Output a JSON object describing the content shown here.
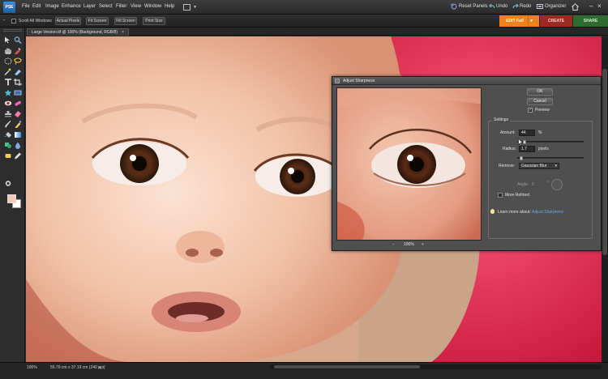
{
  "app": {
    "logo_text": "PSE",
    "menus": [
      "File",
      "Edit",
      "Image",
      "Enhance",
      "Layer",
      "Select",
      "Filter",
      "View",
      "Window",
      "Help"
    ],
    "right_buttons": {
      "reset_panels": "Reset Panels",
      "undo": "Undo",
      "redo": "Redo",
      "organizer": "Organizer"
    }
  },
  "options_bar": {
    "scroll_all_windows": "Scroll All Windows",
    "scroll_all_checked": false,
    "buttons": [
      "Actual Pixels",
      "Fit Screen",
      "Fill Screen",
      "Print Size"
    ]
  },
  "mode_tabs": {
    "edit": "EDIT Full",
    "create": "CREATE",
    "share": "SHARE",
    "colors": {
      "edit": "#f0821e",
      "create": "#9c2a22",
      "share": "#2f6b2f"
    }
  },
  "document": {
    "tab_title": "Large Version.tif @ 100% (Background, RGB/8)",
    "close_glyph": "×"
  },
  "toolbox": {
    "tools": [
      "move-tool",
      "zoom-tool",
      "hand-tool",
      "eyedropper-tool",
      "marquee-tool",
      "lasso-tool",
      "magic-wand-tool",
      "quick-selection-tool",
      "type-tool",
      "crop-tool",
      "cookie-cutter-tool",
      "straighten-tool",
      "red-eye-tool",
      "healing-brush-tool",
      "clone-stamp-tool",
      "eraser-tool",
      "brush-tool",
      "smart-brush-tool",
      "paint-bucket-tool",
      "gradient-tool",
      "shape-tool",
      "blur-tool",
      "sponge-tool",
      "pencil-tool",
      "color-swap-tool"
    ],
    "foreground_color": "#f2c9b8",
    "background_color": "#ffffff"
  },
  "status_bar": {
    "zoom": "100%",
    "doc_info": "55.79 cm x 37.19 cm (240 ppi)"
  },
  "dialog": {
    "title": "Adjust Sharpness",
    "ok": "OK",
    "cancel": "Cancel",
    "preview_label": "Preview",
    "preview_checked": true,
    "zoom_minus": "−",
    "zoom_value": "100%",
    "zoom_plus": "+",
    "settings_label": "Settings",
    "amount_label": "Amount:",
    "amount_value": "44",
    "amount_unit": "%",
    "amount_fraction": 0.09,
    "radius_label": "Radius:",
    "radius_value": "1.7",
    "radius_unit": "pixels",
    "radius_fraction": 0.04,
    "remove_label": "Remove:",
    "remove_value": "Gaussian Blur",
    "angle_label": "Angle:",
    "angle_value": "0",
    "angle_unit": "°",
    "more_refined_label": "More Refined",
    "more_refined_checked": false,
    "learn_prefix": "Learn more about:",
    "learn_link": "Adjust Sharpness"
  }
}
